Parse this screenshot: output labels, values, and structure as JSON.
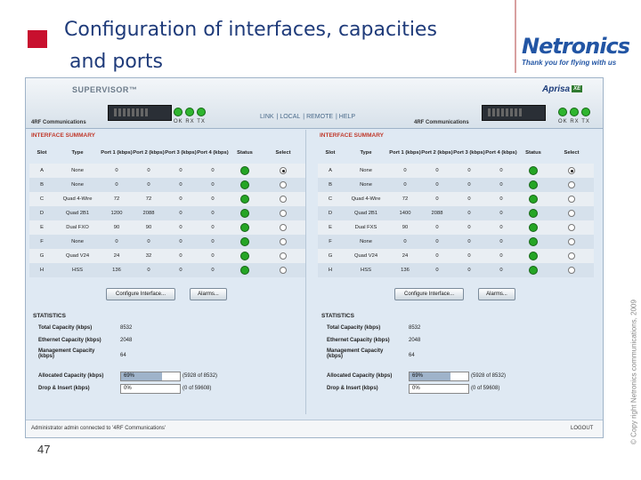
{
  "slide": {
    "title_line1": "Configuration of interfaces, capacities",
    "title_line2": "and ports",
    "page_number": "47",
    "logo_name": "Netronics",
    "logo_tagline": "Thank you for flying with us",
    "copyright": "© Copy right Netronics communications, 2009",
    "accent_color": "#c8102e",
    "title_color": "#1f3b7a"
  },
  "app": {
    "product": "SUPERVISOR™",
    "brand": "Aprisa",
    "brand_badge": "XE",
    "org_left": "4RF Communications",
    "org_right": "4RF Communications",
    "led_labels": "OK RX TX",
    "nav": [
      "LINK",
      "LOCAL",
      "REMOTE",
      "HELP"
    ],
    "footer_status": "Administrator admin connected to '4RF Communications'",
    "logout": "LOGOUT",
    "status_icon": "green-led-icon"
  },
  "left": {
    "section_title": "INTERFACE SUMMARY",
    "headers": [
      "Slot",
      "Type",
      "Port 1 (kbps)",
      "Port 2 (kbps)",
      "Port 3 (kbps)",
      "Port 4 (kbps)",
      "Status",
      "Select"
    ],
    "rows": [
      [
        "A",
        "None",
        "0",
        "0",
        "0",
        "0"
      ],
      [
        "B",
        "None",
        "0",
        "0",
        "0",
        "0"
      ],
      [
        "C",
        "Quad 4-Wire",
        "72",
        "72",
        "0",
        "0"
      ],
      [
        "D",
        "Quad 2B1",
        "1200",
        "2088",
        "0",
        "0"
      ],
      [
        "E",
        "Dual FXO",
        "90",
        "90",
        "0",
        "0"
      ],
      [
        "F",
        "None",
        "0",
        "0",
        "0",
        "0"
      ],
      [
        "G",
        "Quad V24",
        "24",
        "32",
        "0",
        "0"
      ],
      [
        "H",
        "HSS",
        "136",
        "0",
        "0",
        "0"
      ]
    ],
    "selected_row": 0,
    "configure_button": "Configure Interface...",
    "alarms_button": "Alarms...",
    "statistics_title": "STATISTICS",
    "stats": {
      "total_label": "Total Capacity (kbps)",
      "total_value": "8532",
      "ethernet_label": "Ethernet Capacity (kbps)",
      "ethernet_value": "2048",
      "mgmt_label_1": "Management Capacity",
      "mgmt_label_2": "(kbps)",
      "mgmt_value": "64",
      "allocated_label": "Allocated Capacity (kbps)",
      "allocated_pct": "69%",
      "allocated_frac": 0.69,
      "allocated_detail": "(5928 of 8532)",
      "dropinsert_label": "Drop & Insert (kbps)",
      "dropinsert_pct": "0%",
      "dropinsert_frac": 0.0,
      "dropinsert_detail": "(0 of 59608)"
    }
  },
  "right": {
    "section_title": "INTERFACE SUMMARY",
    "headers": [
      "Slot",
      "Type",
      "Port 1 (kbps)",
      "Port 2 (kbps)",
      "Port 3 (kbps)",
      "Port 4 (kbps)",
      "Status",
      "Select"
    ],
    "rows": [
      [
        "A",
        "None",
        "0",
        "0",
        "0",
        "0"
      ],
      [
        "B",
        "None",
        "0",
        "0",
        "0",
        "0"
      ],
      [
        "C",
        "Quad 4-Wire",
        "72",
        "0",
        "0",
        "0"
      ],
      [
        "D",
        "Quad 2B1",
        "1400",
        "2088",
        "0",
        "0"
      ],
      [
        "E",
        "Dual FXS",
        "90",
        "0",
        "0",
        "0"
      ],
      [
        "F",
        "None",
        "0",
        "0",
        "0",
        "0"
      ],
      [
        "G",
        "Quad V24",
        "24",
        "0",
        "0",
        "0"
      ],
      [
        "H",
        "HSS",
        "136",
        "0",
        "0",
        "0"
      ]
    ],
    "selected_row": 0,
    "configure_button": "Configure Interface...",
    "alarms_button": "Alarms...",
    "statistics_title": "STATISTICS",
    "stats": {
      "total_label": "Total Capacity (kbps)",
      "total_value": "8532",
      "ethernet_label": "Ethernet Capacity (kbps)",
      "ethernet_value": "2048",
      "mgmt_label_1": "Management Capacity",
      "mgmt_label_2": "(kbps)",
      "mgmt_value": "64",
      "allocated_label": "Allocated Capacity (kbps)",
      "allocated_pct": "69%",
      "allocated_frac": 0.69,
      "allocated_detail": "(5928 of 8532)",
      "dropinsert_label": "Drop & Insert (kbps)",
      "dropinsert_pct": "0%",
      "dropinsert_frac": 0.0,
      "dropinsert_detail": "(0 of 59608)"
    }
  }
}
